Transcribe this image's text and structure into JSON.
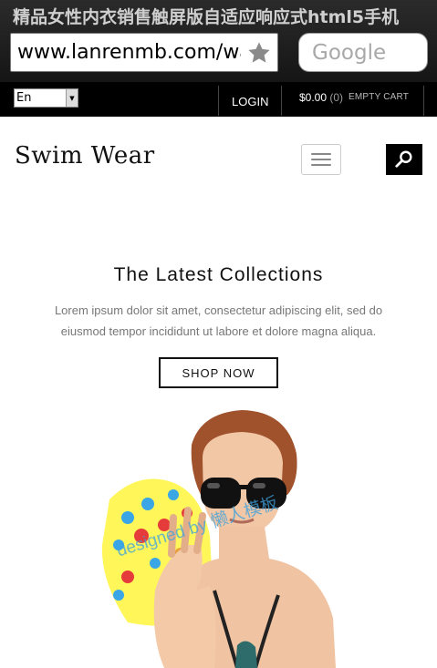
{
  "browser": {
    "title": "精品女性内衣销售触屏版自适应响应式html5手机",
    "url": "www.lanrenmb.com/wap",
    "search_placeholder": "Google"
  },
  "topbar": {
    "language": "En",
    "login_label": "LOGIN",
    "cart_amount": "$0.00",
    "cart_count": "(0)",
    "cart_empty_label": "EMPTY CART"
  },
  "header": {
    "logo": "Swim Wear"
  },
  "hero": {
    "title": "The Latest Collections",
    "text": "Lorem ipsum dolor sit amet, consectetur adipiscing elit, sed do eiusmod tempor incididunt ut labore et dolore magna aliqua.",
    "button_label": "SHOP NOW",
    "watermark": "designed by 懒人模板"
  },
  "icons": {
    "bookmark": "star-icon",
    "search": "search-icon",
    "menu": "hamburger-menu-icon",
    "dropdown": "dropdown-arrow-icon"
  },
  "colors": {
    "browser_bar": "#1e1e1e",
    "topbar": "#000000",
    "accent": "#111111"
  }
}
